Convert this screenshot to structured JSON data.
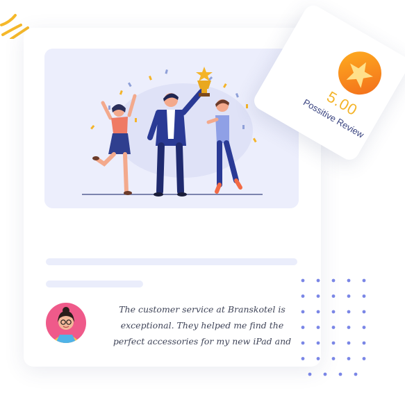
{
  "rating": {
    "score": "5.00",
    "label": "Possitive Review",
    "accent": "#f4b429"
  },
  "testimonial": {
    "lines": [
      "The customer service at Branskotel is",
      "exceptional. They helped me find the",
      "perfect accessories for my new iPad and"
    ]
  },
  "icons": {
    "badge": "star-icon",
    "decor": "sparkle-icon",
    "illustration": "celebration-trophy-illustration"
  },
  "colors": {
    "brand": "#3a4480",
    "badge_gradient": [
      "#ffb020",
      "#f26a1b"
    ],
    "dot": "#7a86e6"
  }
}
